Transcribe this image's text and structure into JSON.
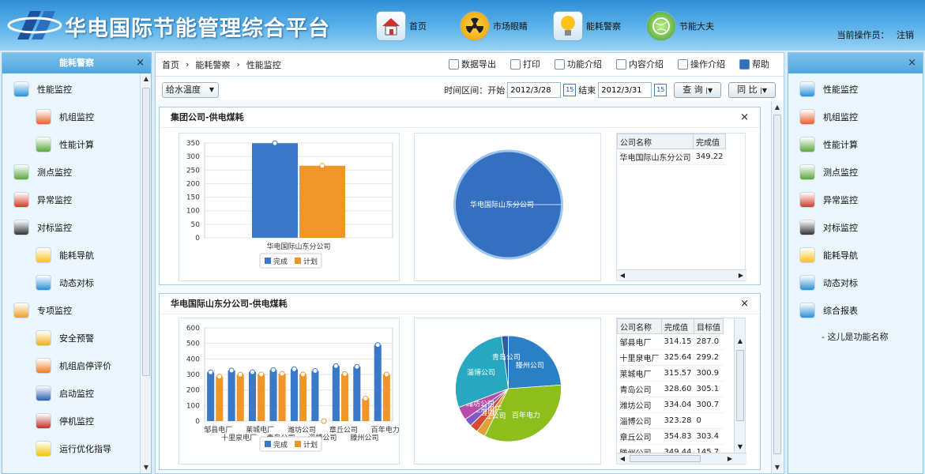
{
  "header": {
    "title": "华电国际节能管理综合平台",
    "operator_label": "当前操作员：",
    "logout": "注销",
    "nav": [
      {
        "label": "首页",
        "icon": "home-icon"
      },
      {
        "label": "市场眼睛",
        "icon": "radiation-icon"
      },
      {
        "label": "能耗警察",
        "icon": "bulb-icon"
      },
      {
        "label": "节能大夫",
        "icon": "globe-icon"
      }
    ]
  },
  "left_panel": {
    "title": "能耗警察",
    "close": "×",
    "items": [
      {
        "label": "性能监控",
        "level": 1,
        "icon": "monitor-icon"
      },
      {
        "label": "机组监控",
        "level": 2,
        "icon": "unit-icon"
      },
      {
        "label": "性能计算",
        "level": 2,
        "icon": "calc-icon"
      },
      {
        "label": "测点监控",
        "level": 1,
        "icon": "point-icon"
      },
      {
        "label": "异常监控",
        "level": 1,
        "icon": "alert-icon"
      },
      {
        "label": "对标监控",
        "level": 1,
        "icon": "traffic-light-icon"
      },
      {
        "label": "能耗导航",
        "level": 2,
        "icon": "bulb-icon"
      },
      {
        "label": "动态对标",
        "level": 2,
        "icon": "chart-icon"
      },
      {
        "label": "专项监控",
        "level": 1,
        "icon": "hand-icon"
      },
      {
        "label": "安全预警",
        "level": 2,
        "icon": "warning-icon"
      },
      {
        "label": "机组启停评价",
        "level": 2,
        "icon": "gear-icon"
      },
      {
        "label": "启动监控",
        "level": 2,
        "icon": "shield-icon"
      },
      {
        "label": "停机监控",
        "level": 2,
        "icon": "stop-shield-icon"
      },
      {
        "label": "运行优化指导",
        "level": 2,
        "icon": "smile-icon"
      }
    ]
  },
  "right_panel": {
    "close": "×",
    "items": [
      {
        "label": "性能监控",
        "icon": "monitor-icon"
      },
      {
        "label": "机组监控",
        "icon": "unit-icon"
      },
      {
        "label": "性能计算",
        "icon": "calc-icon"
      },
      {
        "label": "测点监控",
        "icon": "point-icon"
      },
      {
        "label": "异常监控",
        "icon": "alert-icon"
      },
      {
        "label": "对标监控",
        "icon": "traffic-light-icon"
      },
      {
        "label": "能耗导航",
        "icon": "bulb-icon"
      },
      {
        "label": "动态对标",
        "icon": "chart-icon"
      },
      {
        "label": "综合报表",
        "icon": "folder-icon"
      }
    ],
    "hint": "- 这儿是功能名称"
  },
  "breadcrumb": [
    "首页",
    "能耗警察",
    "性能监控"
  ],
  "toolbar": [
    "数据导出",
    "打印",
    "功能介绍",
    "内容介绍",
    "操作介绍",
    "帮助"
  ],
  "filter": {
    "select": "给水温度",
    "range_label": "时间区间：开始",
    "start": "2012/3/28",
    "end_label": "结束",
    "end": "2012/3/31",
    "cal": "15",
    "query": "查 询",
    "compare": "同 比"
  },
  "colors": {
    "done": "#3a78c8",
    "plan": "#f0952a",
    "accent": "#4fa6de"
  },
  "chart_data": [
    {
      "type": "bar",
      "title": "集团公司-供电煤耗",
      "categories": [
        "华电国际山东分公司"
      ],
      "ylim": [
        0,
        350
      ],
      "yticks": [
        0,
        50,
        100,
        150,
        200,
        250,
        300,
        350
      ],
      "series": [
        {
          "name": "完成",
          "values": [
            349.22
          ]
        },
        {
          "name": "计划",
          "values": [
            266
          ]
        }
      ],
      "legend": [
        "完成",
        "计划"
      ],
      "pie": [
        {
          "label": "华电国际山东分公司",
          "value": 349.22
        }
      ],
      "table": {
        "headers": [
          "公司名称",
          "完成值"
        ],
        "rows": [
          [
            "华电国际山东分公司",
            "349.22"
          ]
        ]
      }
    },
    {
      "type": "bar",
      "title": "华电国际山东分公司-供电煤耗",
      "categories": [
        "邹县电厂",
        "十里泉电厂",
        "莱城电厂",
        "青岛公司",
        "潍坊公司",
        "淄博公司",
        "章丘公司",
        "滕州公司",
        "百年电力"
      ],
      "xlabels_top": [
        "邹县电厂",
        "莱城电厂",
        "潍坊公司",
        "章丘公司",
        "百年电力"
      ],
      "xlabels_bottom": [
        "十里泉电厂",
        "青岛公司",
        "淄博公司",
        "滕州公司"
      ],
      "ylim": [
        0,
        600
      ],
      "yticks": [
        0,
        100,
        200,
        300,
        400,
        500,
        600
      ],
      "series": [
        {
          "name": "完成",
          "values": [
            314.15,
            325.64,
            315.57,
            328.6,
            334.04,
            323.28,
            354.83,
            349.44,
            490
          ]
        },
        {
          "name": "计划",
          "values": [
            287.0,
            299.2,
            300.9,
            305.1,
            300.7,
            0,
            303.4,
            145,
            300
          ]
        }
      ],
      "legend": [
        "完成",
        "计划"
      ],
      "pie": [
        {
          "label": "滕州公司",
          "value": 349.44
        },
        {
          "label": "百年电力",
          "value": 490
        },
        {
          "label": "章丘公司",
          "value": 40
        },
        {
          "label": "邹县电厂",
          "value": 38
        },
        {
          "label": "十里泉电厂",
          "value": 36
        },
        {
          "label": "潍坊公司",
          "value": 60
        },
        {
          "label": "淄博公司",
          "value": 420
        },
        {
          "label": "青岛公司",
          "value": 30
        }
      ],
      "table": {
        "headers": [
          "公司名称",
          "完成值",
          "目标值"
        ],
        "rows": [
          [
            "邹县电厂",
            "314.15",
            "287.0"
          ],
          [
            "十里泉电厂",
            "325.64",
            "299.2"
          ],
          [
            "莱城电厂",
            "315.57",
            "300.9"
          ],
          [
            "青岛公司",
            "328.60",
            "305.1"
          ],
          [
            "潍坊公司",
            "334.04",
            "300.7"
          ],
          [
            "淄博公司",
            "323.28",
            "0"
          ],
          [
            "章丘公司",
            "354.83",
            "303.4"
          ],
          [
            "滕州公司",
            "349.44",
            "145.7"
          ]
        ]
      }
    }
  ]
}
